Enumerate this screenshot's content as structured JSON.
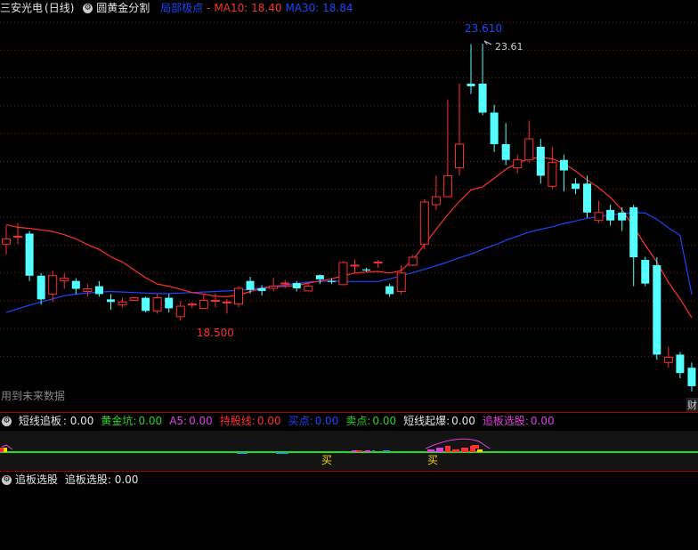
{
  "main": {
    "stock_title": "三安光电",
    "period": "(日线)",
    "indicator_name": "圆黄金分割",
    "ma_labels": [
      {
        "text": "局部极点",
        "color": "#1e46ff"
      },
      {
        "text": "-",
        "color": "#ff3030"
      },
      {
        "text": "MA10: 18.40",
        "color": "#ff3030"
      },
      {
        "text": "MA30: 18.84",
        "color": "#1e46ff"
      }
    ],
    "peak_label": "23.610",
    "peak_marker": "23.61",
    "low_label": "18.500",
    "future_data": "用到未来数据",
    "corner_badge": "财"
  },
  "indicator": {
    "items": [
      {
        "label": "短线追板",
        "value": ": 0.00",
        "color": "#e6e6e6"
      },
      {
        "label": "黄金坑:",
        "value": "0.00",
        "color": "#29d329"
      },
      {
        "label": "A5:",
        "value": "0.00",
        "color": "#e040e0"
      },
      {
        "label": "持股线:",
        "value": "0.00",
        "color": "#ff3030"
      },
      {
        "label": "买点:",
        "value": "0.00",
        "color": "#1e46ff"
      },
      {
        "label": "卖点:",
        "value": "0.00",
        "color": "#29d329"
      },
      {
        "label": "短线起爆:",
        "value": "0.00",
        "color": "#e6e6e6"
      },
      {
        "label": "追板选股:",
        "value": "0.00",
        "color": "#e040e0"
      }
    ],
    "buy_marks": [
      "买",
      "买"
    ]
  },
  "selection": {
    "title": "追板选股",
    "item": "追板选股: 0.00"
  },
  "chart_data": {
    "type": "candlestick",
    "peak": 23.61,
    "low": 18.5,
    "ma10_last": 18.4,
    "ma30_last": 18.84,
    "candles": [
      [
        19.8,
        19.9,
        20.15,
        19.6
      ],
      [
        19.95,
        19.95,
        20.2,
        19.8
      ],
      [
        20.0,
        19.2,
        20.05,
        19.1
      ],
      [
        19.2,
        18.75,
        19.25,
        18.65
      ],
      [
        18.85,
        19.2,
        19.3,
        18.7
      ],
      [
        19.1,
        19.15,
        19.25,
        18.95
      ],
      [
        19.1,
        18.95,
        19.15,
        18.85
      ],
      [
        18.9,
        18.95,
        19.05,
        18.8
      ],
      [
        19.0,
        18.85,
        19.1,
        18.8
      ],
      [
        18.75,
        18.7,
        18.85,
        18.55
      ],
      [
        18.65,
        18.7,
        18.78,
        18.6
      ],
      [
        18.73,
        18.78,
        18.8,
        18.72
      ],
      [
        18.78,
        18.53,
        18.8,
        18.5
      ],
      [
        18.53,
        18.78,
        18.85,
        18.48
      ],
      [
        18.78,
        18.58,
        18.85,
        18.5
      ],
      [
        18.42,
        18.62,
        18.72,
        18.35
      ],
      [
        18.66,
        18.66,
        18.7,
        18.58
      ],
      [
        18.58,
        18.73,
        18.85,
        18.58
      ],
      [
        18.73,
        18.73,
        18.86,
        18.6
      ],
      [
        18.7,
        18.7,
        18.76,
        18.48
      ],
      [
        18.66,
        18.96,
        19.0,
        18.6
      ],
      [
        19.1,
        18.93,
        19.18,
        18.86
      ],
      [
        18.96,
        18.91,
        19.02,
        18.82
      ],
      [
        18.96,
        19.0,
        19.16,
        18.9
      ],
      [
        19.06,
        19.06,
        19.12,
        18.96
      ],
      [
        19.06,
        18.96,
        19.1,
        18.9
      ],
      [
        18.91,
        19.0,
        19.06,
        18.9
      ],
      [
        19.21,
        19.13,
        19.22,
        19.04
      ],
      [
        19.1,
        19.08,
        19.15,
        19.04
      ],
      [
        19.03,
        19.45,
        19.48,
        19.02
      ],
      [
        19.4,
        19.4,
        19.5,
        19.25
      ],
      [
        19.32,
        19.3,
        19.35,
        19.28
      ],
      [
        19.45,
        19.46,
        19.5,
        19.35
      ],
      [
        19.0,
        18.85,
        19.05,
        18.8
      ],
      [
        18.9,
        19.25,
        19.4,
        18.85
      ],
      [
        19.4,
        19.55,
        19.6,
        19.38
      ],
      [
        19.8,
        20.6,
        20.65,
        19.7
      ],
      [
        20.55,
        20.7,
        21.1,
        20.45
      ],
      [
        20.7,
        21.1,
        22.55,
        20.7
      ],
      [
        21.25,
        21.7,
        22.85,
        21.1
      ],
      [
        22.85,
        22.8,
        23.6,
        22.65
      ],
      [
        22.85,
        22.3,
        23.61,
        22.25
      ],
      [
        22.3,
        21.7,
        22.45,
        21.55
      ],
      [
        21.7,
        21.4,
        22.1,
        21.3
      ],
      [
        21.25,
        21.4,
        21.5,
        21.15
      ],
      [
        21.4,
        21.8,
        22.15,
        21.35
      ],
      [
        21.65,
        21.1,
        21.8,
        20.95
      ],
      [
        20.9,
        21.35,
        21.65,
        20.85
      ],
      [
        21.4,
        21.2,
        21.5,
        20.8
      ],
      [
        20.95,
        20.85,
        21.05,
        20.75
      ],
      [
        20.95,
        20.4,
        21.1,
        20.3
      ],
      [
        20.25,
        20.4,
        20.62,
        20.2
      ],
      [
        20.45,
        20.25,
        20.55,
        20.15
      ],
      [
        20.4,
        20.25,
        20.5,
        20.05
      ],
      [
        20.5,
        19.55,
        20.55,
        19.0
      ],
      [
        19.5,
        19.05,
        19.56,
        19.0
      ],
      [
        19.4,
        17.7,
        19.55,
        17.6
      ],
      [
        17.55,
        17.65,
        17.85,
        17.45
      ],
      [
        17.7,
        17.35,
        17.75,
        17.25
      ],
      [
        17.45,
        17.1,
        17.55,
        17.0
      ]
    ],
    "ma10": [
      20.17,
      20.12,
      20.1,
      20.07,
      20.04,
      19.98,
      19.9,
      19.79,
      19.7,
      19.56,
      19.46,
      19.31,
      19.16,
      19.04,
      19.0,
      18.94,
      18.88,
      18.85,
      18.81,
      18.8,
      18.83,
      18.9,
      18.96,
      18.99,
      19.0,
      19.01,
      19.06,
      19.1,
      19.14,
      19.2,
      19.25,
      19.27,
      19.28,
      19.25,
      19.3,
      19.5,
      19.79,
      20.08,
      20.36,
      20.61,
      20.83,
      20.89,
      21.05,
      21.22,
      21.34,
      21.42,
      21.45,
      21.42,
      21.33,
      21.19,
      21.02,
      20.87,
      20.69,
      20.45,
      20.13,
      19.78,
      19.46,
      19.07,
      18.76,
      18.4
    ],
    "ma30": [
      18.5,
      18.57,
      18.64,
      18.7,
      18.76,
      18.82,
      18.85,
      18.87,
      18.89,
      18.9,
      18.89,
      18.88,
      18.87,
      18.86,
      18.86,
      18.87,
      18.88,
      18.89,
      18.9,
      18.91,
      18.92,
      18.94,
      18.97,
      19.0,
      19.02,
      19.05,
      19.08,
      19.09,
      19.1,
      19.09,
      19.09,
      19.09,
      19.09,
      19.14,
      19.2,
      19.26,
      19.32,
      19.39,
      19.46,
      19.54,
      19.61,
      19.7,
      19.78,
      19.87,
      19.95,
      20.03,
      20.08,
      20.13,
      20.19,
      20.24,
      20.29,
      20.32,
      20.36,
      20.37,
      20.4,
      20.39,
      20.27,
      20.11,
      19.96,
      18.84
    ],
    "ylim": [
      17.2,
      24.0
    ]
  }
}
